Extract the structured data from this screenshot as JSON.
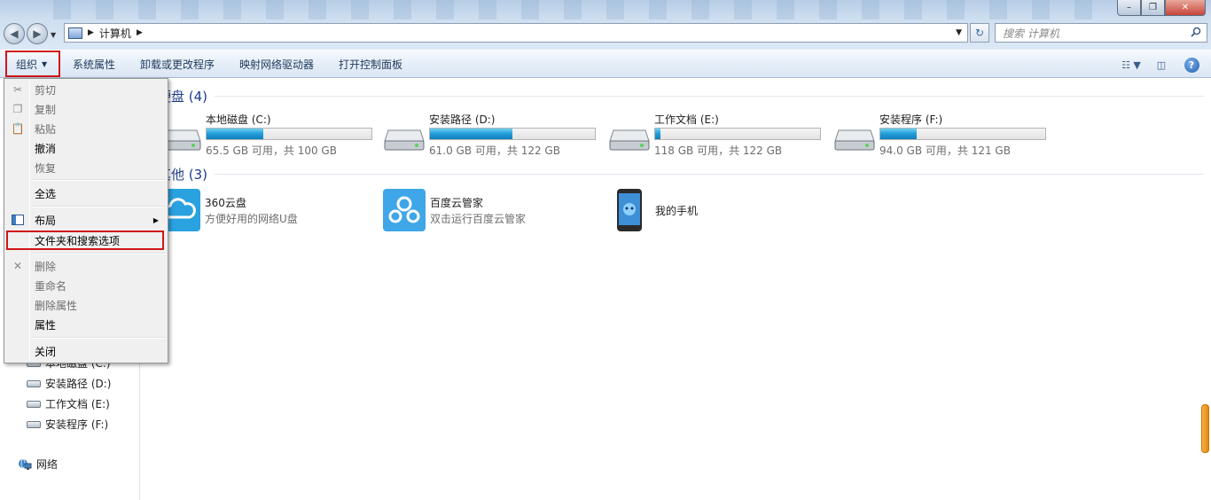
{
  "address": {
    "crumb": "计算机"
  },
  "search": {
    "placeholder": "搜索 计算机"
  },
  "toolbar": {
    "organize": "组织",
    "system_properties": "系统属性",
    "uninstall": "卸载或更改程序",
    "map_drive": "映射网络驱动器",
    "control_panel": "打开控制面板",
    "help": "?"
  },
  "groups": {
    "hdd_title": "硬盘 (4)",
    "other_title": "其他 (3)"
  },
  "drives": [
    {
      "name": "本地磁盘 (C:)",
      "free": "65.5 GB 可用，共 100 GB",
      "used_fraction": 0.345
    },
    {
      "name": "安装路径 (D:)",
      "free": "61.0 GB 可用，共 122 GB",
      "used_fraction": 0.5
    },
    {
      "name": "工作文档 (E:)",
      "free": "118 GB 可用，共 122 GB",
      "used_fraction": 0.033
    },
    {
      "name": "安装程序 (F:)",
      "free": "94.0 GB 可用，共 121 GB",
      "used_fraction": 0.223
    }
  ],
  "others": [
    {
      "name": "360云盘",
      "desc": "方便好用的网络U盘"
    },
    {
      "name": "百度云管家",
      "desc": "双击运行百度云管家"
    },
    {
      "name": "我的手机",
      "desc": ""
    }
  ],
  "navpane": {
    "items": [
      {
        "label": "本地磁盘 (C:)"
      },
      {
        "label": "安装路径 (D:)"
      },
      {
        "label": "工作文档 (E:)"
      },
      {
        "label": "安装程序 (F:)"
      }
    ],
    "network": "网络"
  },
  "menu": {
    "cut": "剪切",
    "copy": "复制",
    "paste": "粘贴",
    "undo": "撤消",
    "redo": "恢复",
    "select_all": "全选",
    "layout": "布局",
    "folder_options": "文件夹和搜索选项",
    "delete": "删除",
    "rename": "重命名",
    "remove_properties": "删除属性",
    "properties": "属性",
    "close": "关闭"
  },
  "colors": {
    "highlight_border": "#d0161a",
    "bar_fill": "#26a0da",
    "group_title": "#1e3a8a"
  }
}
